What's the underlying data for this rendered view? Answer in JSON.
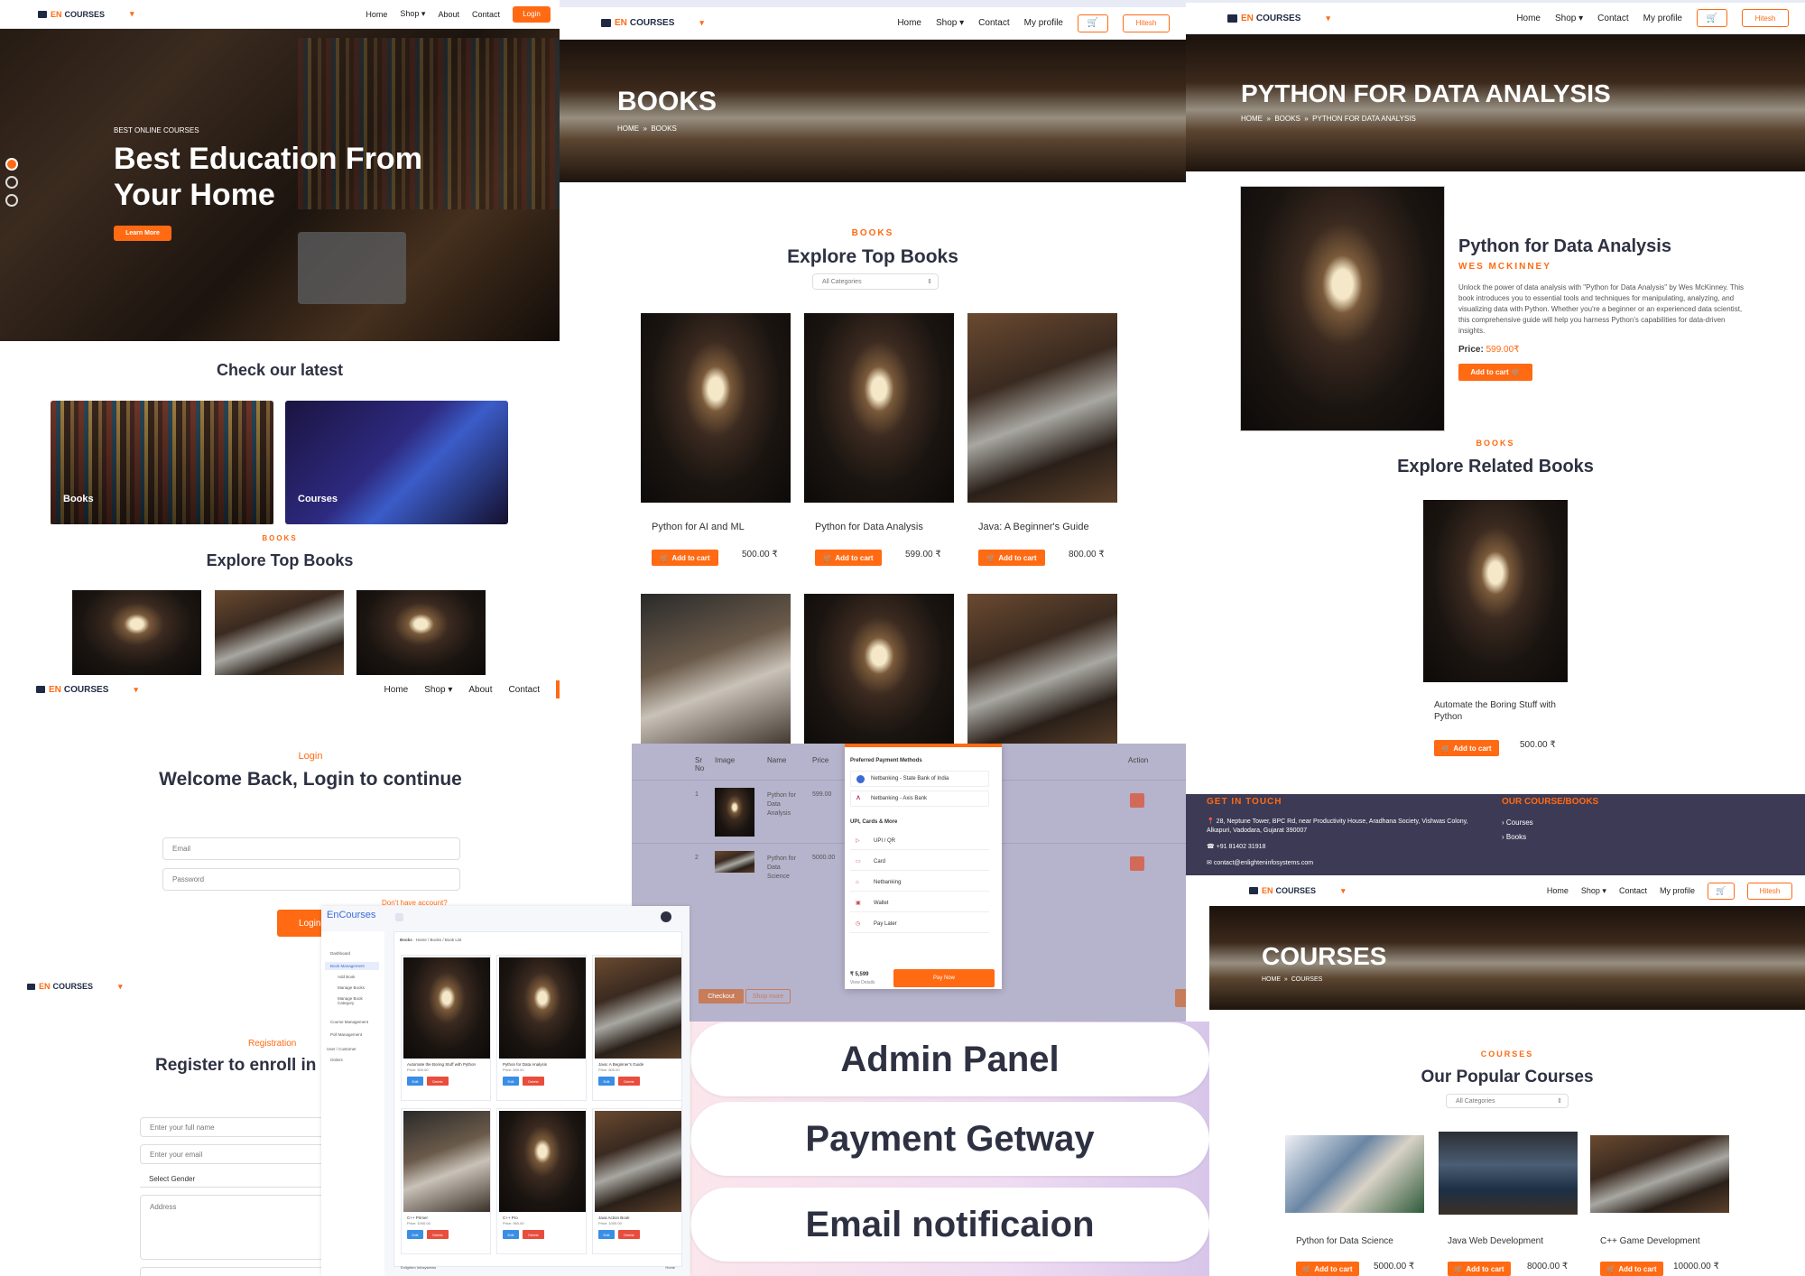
{
  "brand": {
    "en": "EN",
    "name": "COURSES"
  },
  "nav": {
    "home": "Home",
    "shop": "Shop",
    "about": "About",
    "contact": "Contact",
    "login": "Login",
    "profile": "My profile",
    "user": "Hitesh"
  },
  "hero": {
    "kicker": "BEST ONLINE COURSES",
    "title": "Best Education From Your Home",
    "cta": "Learn More"
  },
  "latest": {
    "heading": "Check our latest",
    "tiles": [
      "Books",
      "Courses"
    ]
  },
  "top_books": {
    "kicker": "BOOKS",
    "heading": "Explore Top Books",
    "filter": "All Categories"
  },
  "books_page": {
    "banner": "BOOKS",
    "crumb_home": "HOME",
    "crumb_current": "BOOKS",
    "cards": [
      {
        "title": "Python for AI and ML",
        "price": "500.00 ₹"
      },
      {
        "title": "Python for Data Analysis",
        "price": "599.00 ₹"
      },
      {
        "title": "Java: A Beginner's Guide",
        "price": "800.00 ₹"
      }
    ],
    "add_cart": "Add to cart"
  },
  "detail": {
    "banner": "PYTHON FOR DATA ANALYSIS",
    "crumb": [
      "HOME",
      "BOOKS",
      "PYTHON FOR DATA ANALYSIS"
    ],
    "title": "Python for Data Analysis",
    "author": "WES MCKINNEY",
    "desc": "Unlock the power of data analysis with \"Python for Data Analysis\" by Wes McKinney. This book introduces you to essential tools and techniques for manipulating, analyzing, and visualizing data with Python. Whether you're a beginner or an experienced data scientist, this comprehensive guide will help you harness Python's capabilities for data-driven insights.",
    "price_label": "Price:",
    "price": "599.00₹",
    "add_cart": "Add to cart",
    "related_kicker": "BOOKS",
    "related_heading": "Explore Related Books",
    "related_title": "Automate the Boring Stuff with Python",
    "related_price": "500.00 ₹"
  },
  "footer": {
    "touch": "GET IN TOUCH",
    "address": "28, Neptune Tower, BPC Rd, near Productivity House, Aradhana Society, Vishwas Colony, Alkapuri, Vadodara, Gujarat 390007",
    "phone": "+91 81402 31918",
    "email": "contact@enlighteninfosystems.com",
    "links_title": "OUR COURSE/BOOKS",
    "links": [
      "Courses",
      "Books"
    ]
  },
  "login": {
    "kicker": "Login",
    "heading": "Welcome Back, Login to continue",
    "email_ph": "Email",
    "password_ph": "Password",
    "no_account": "Don't have account?",
    "button": "Login"
  },
  "register": {
    "kicker": "Registration",
    "heading": "Register to enroll in",
    "name_ph": "Enter your full name",
    "email_ph": "Enter your email",
    "gender": "Select Gender",
    "address_ph": "Address"
  },
  "admin": {
    "brand": "EnCourses",
    "sidebar": [
      "Dashboard",
      "Book Management",
      "Add Book",
      "Manage Books",
      "Manage Book Category",
      "Course Management",
      "Poll Management",
      "User / Customer",
      "Orders"
    ],
    "crumb": [
      "Books",
      "Home",
      "Books",
      "Book List"
    ],
    "books": [
      {
        "title": "Automate the Boring Stuff with Python",
        "price": "Price: 500.00"
      },
      {
        "title": "Python for Data Analysis",
        "price": "Price: 599.00"
      },
      {
        "title": "Java: A Beginner's Guide",
        "price": "Price: 800.00"
      },
      {
        "title": "C++ Primer",
        "price": "Price: 1000.00"
      },
      {
        "title": "C++ Pro",
        "price": "Price: 950.00"
      },
      {
        "title": "Java Action Book",
        "price": "Price: 1000.00"
      }
    ],
    "edit": "Edit",
    "delete": "Delete",
    "footer_left": "Enlighten Infosystems",
    "footer_right": "Home"
  },
  "cart": {
    "headers": [
      "Sr No",
      "Image",
      "Name",
      "Price",
      "Action"
    ],
    "rows": [
      {
        "sr": "1",
        "name": "Python for Data Analysis",
        "price": "599.00"
      },
      {
        "sr": "2",
        "name": "Python for Data Science",
        "price": "5000.00"
      }
    ],
    "checkout": "Checkout",
    "shop_more": "Shop more"
  },
  "payment": {
    "preferred": "Preferred Payment Methods",
    "banks": [
      "Netbanking - State Bank of India",
      "Netbanking - Axis Bank"
    ],
    "section": "UPI, Cards & More",
    "methods": [
      "UPI / QR",
      "Card",
      "Netbanking",
      "Wallet",
      "Pay Later"
    ],
    "amount": "₹ 5,599",
    "view": "View Details",
    "pay": "Pay Now"
  },
  "features": [
    "Admin Panel",
    "Payment Getway",
    "Email notificaion"
  ],
  "courses_page": {
    "banner": "COURSES",
    "crumb_home": "HOME",
    "crumb_current": "COURSES",
    "kicker": "COURSES",
    "heading": "Our Popular Courses",
    "filter": "All Categories",
    "cards": [
      {
        "title": "Python for Data Science",
        "price": "5000.00 ₹"
      },
      {
        "title": "Java Web Development",
        "price": "8000.00 ₹"
      },
      {
        "title": "C++ Game Development",
        "price": "10000.00 ₹"
      }
    ],
    "add_cart": "Add to cart"
  },
  "colors": {
    "accent": "#ff6a13",
    "navy": "#2e3142",
    "footer": "#3d3a55"
  }
}
